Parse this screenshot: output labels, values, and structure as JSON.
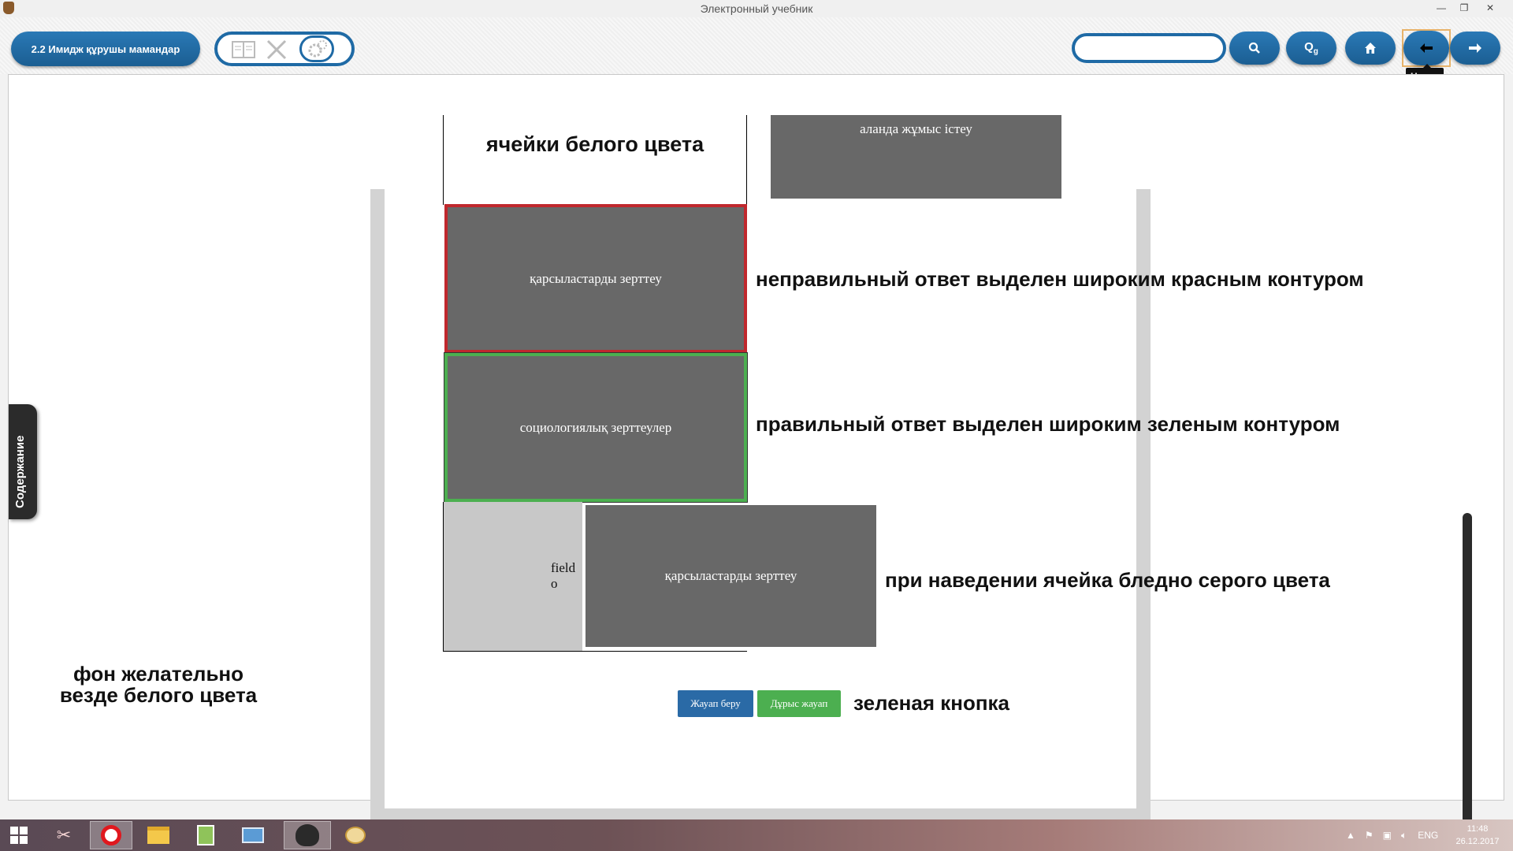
{
  "window": {
    "title": "Электронный учебник"
  },
  "toolbar": {
    "chapter_label": "2.2 Имидж құрушы мамандар",
    "search_placeholder": "",
    "tooltip": "Назад"
  },
  "sidebar": {
    "tab_label": "Содержание"
  },
  "exercise": {
    "top_white_label": "ячейки белого цвета",
    "top_right_cell": "аланда жұмыс істеу",
    "wrong_cell": "қарсыластарды зерттеу",
    "correct_cell": "социологиялық зерттеулер",
    "hover_cell_partial": "field o",
    "drag_cell": "қарсыластарды зерттеу",
    "answer_button": "Жауап беру",
    "correct_answer_button": "Дұрыс жауап"
  },
  "notes": {
    "wrong": "неправильный ответ выделен широким красным контуром",
    "correct": "правильный ответ выделен широким зеленым контуром",
    "hover": "при наведении ячейка бледно серого цвета",
    "green_button": "зеленая кнопка",
    "bg_line1": "фон желательно",
    "bg_line2": "везде белого цвета"
  },
  "colors": {
    "accent": "#1f6aa5",
    "cell_gray": "#686868",
    "hover_gray": "#c8c8c8",
    "wrong": "#c0282d",
    "correct": "#4caf50"
  },
  "taskbar": {
    "lang": "ENG",
    "time": "11:48",
    "date": "26.12.2017"
  }
}
